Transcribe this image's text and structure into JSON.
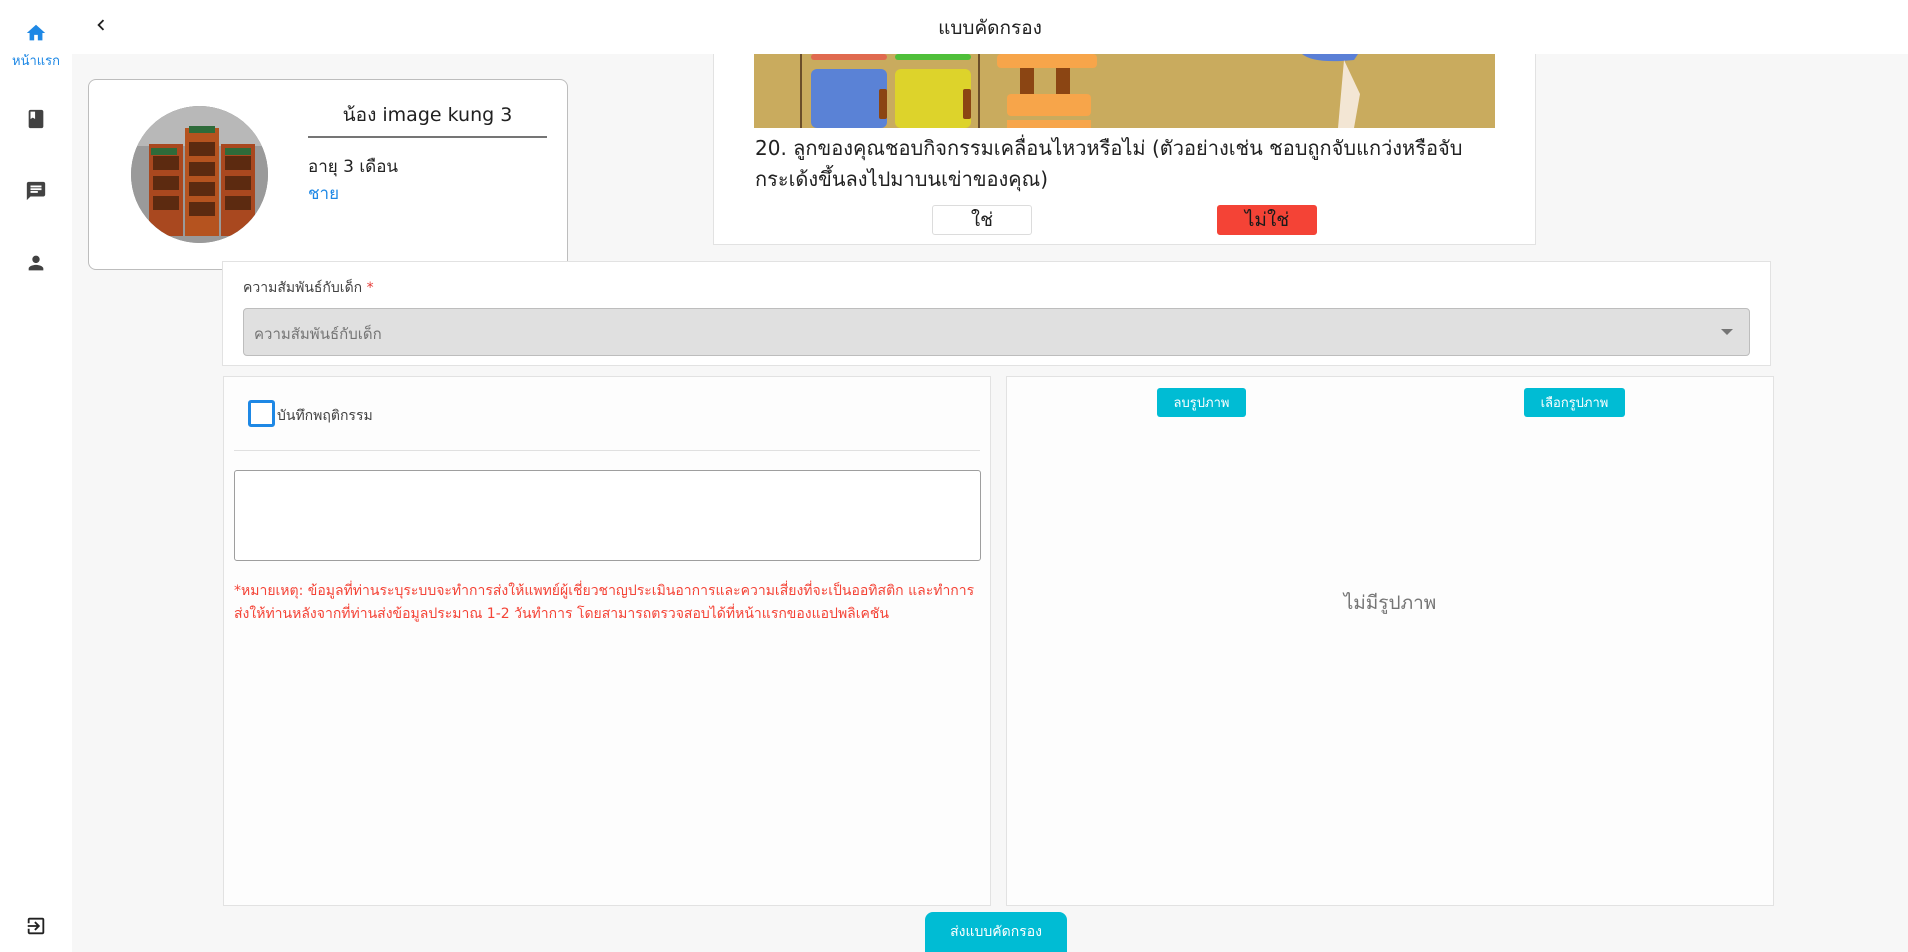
{
  "app": {
    "page_title": "แบบคัดกรอง"
  },
  "sidebar": {
    "items": [
      {
        "icon": "home-icon",
        "label": "หน้าแรก",
        "active": true
      },
      {
        "icon": "book-icon",
        "label": ""
      },
      {
        "icon": "chat-icon",
        "label": ""
      },
      {
        "icon": "person-icon",
        "label": ""
      },
      {
        "icon": "logout-icon",
        "label": ""
      }
    ],
    "active_color": "#1e88e5"
  },
  "profile": {
    "name": "น้อง image kung 3",
    "age": "อายุ 3 เดือน",
    "gender": "ชาย"
  },
  "question": {
    "text": "20. ลูกของคุณชอบกิจกรรมเคลื่อนไหวหรือไม่ (ตัวอย่างเช่น ชอบถูกจับแกว่งหรือจับกระเด้งขึ้นลงไปมาบนเข่าของคุณ)",
    "yes_label": "ใช่",
    "no_label": "ไม่ใช่",
    "selected": "ไม่ใช่"
  },
  "relationship": {
    "label": "ความสัมพันธ์กับเด็ก",
    "required_mark": "*",
    "placeholder": "ความสัมพันธ์กับเด็ก"
  },
  "behavior": {
    "checkbox_label": "บันทึกพฤติกรรม",
    "checked": false,
    "notes_value": "",
    "disclaimer": "*หมายเหตุ: ข้อมูลที่ท่านระบุระบบจะทำการส่งให้แพทย์ผู้เชี่ยวชาญประเมินอาการและความเสี่ยงที่จะเป็นออทิสติก และทำการส่งให้ท่านหลังจากที่ท่านส่งข้อมูลประมาณ 1-2 วันทำการ โดยสามารถตรวจสอบได้ที่หน้าแรกของแอปพลิเคชัน"
  },
  "image_panel": {
    "delete_label": "ลบรูปภาพ",
    "choose_label": "เลือกรูปภาพ",
    "empty_text": "ไม่มีรูปภาพ"
  },
  "submit": {
    "label": "ส่งแบบคัดกรอง"
  },
  "colors": {
    "accent": "#00bcd4",
    "no_button": "#f44336",
    "link_blue": "#1e88e5",
    "warning_text": "#f44336"
  }
}
